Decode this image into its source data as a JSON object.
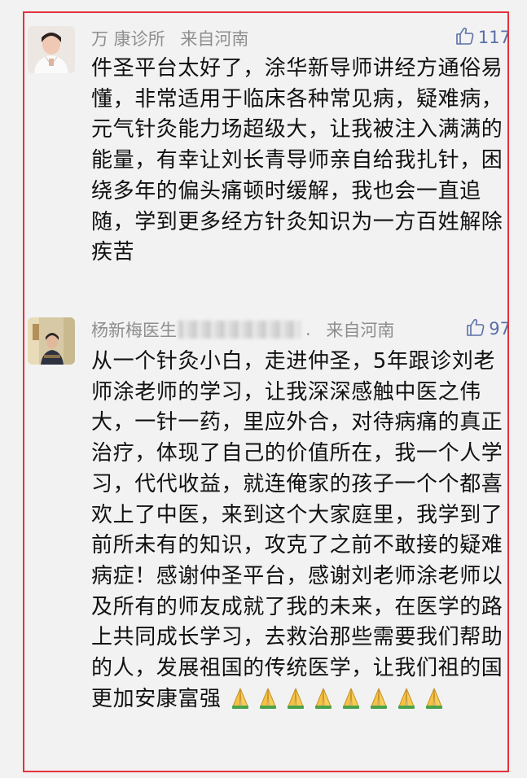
{
  "comments": [
    {
      "name": "万 康诊所",
      "location": "来自河南",
      "likes": "117",
      "text": "件圣平台太好了，涂华新导师讲经方通俗易懂，非常适用于临床各种常见病，疑难病，元气针灸能力场超级大，让我被注入满满的能量，有幸让刘长青导师亲自给我扎针，困绕多年的偏头痛顿时缓解，我也会一直追随，学到更多经方针灸知识为一方百姓解除疾苦"
    },
    {
      "name": "杨新梅医生",
      "location": "来自河南",
      "likes": "97",
      "dot": ".",
      "text": "从一个针灸小白，走进仲圣，5年跟诊刘老师涂老师的学习，让我深深感触中医之伟大，一针一药，里应外合，对待病痛的真正治疗，体现了自己的价值所在，我一个人学习，代代收益，就连俺家的孩子一个个都喜欢上了中医，来到这个大家庭里，我学到了前所未有的知识，攻克了之前不敢接的疑难病症！感谢仲圣平台，感谢刘老师涂老师以及所有的师友成就了我的未来，在医学的路上共同成长学习，去救治那些需要我们帮助的人，发展祖国的传统医学，让我们祖的国更加安康富强"
    }
  ],
  "icons": {
    "like": "thumbs-up-outline-icon",
    "emoji": "folded-hands-emoji"
  },
  "colors": {
    "frame_border": "#e5313a",
    "meta_text": "#8e8e8e",
    "like_color": "#5a6fa8",
    "body_text": "#111111"
  }
}
